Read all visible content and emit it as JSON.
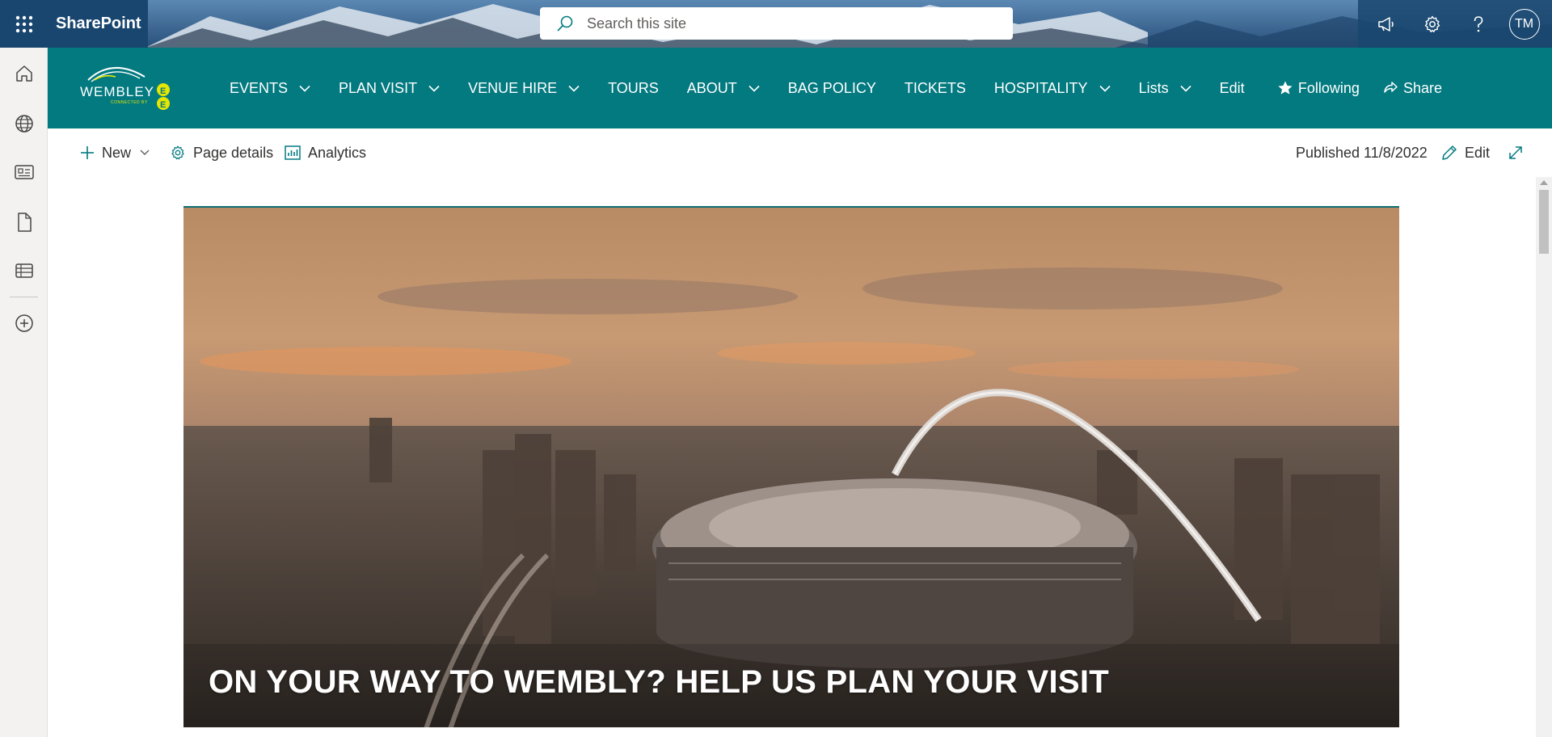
{
  "suite_bar": {
    "brand": "SharePoint",
    "search_placeholder": "Search this site",
    "avatar_initials": "TM"
  },
  "hub_nav": {
    "logo": {
      "text": "WEMBLEY",
      "sub_text": "CONNECTED BY",
      "partner_letters": "EE"
    },
    "items": [
      {
        "label": "EVENTS",
        "has_dropdown": true
      },
      {
        "label": "PLAN VISIT",
        "has_dropdown": true
      },
      {
        "label": "VENUE HIRE",
        "has_dropdown": true
      },
      {
        "label": "TOURS",
        "has_dropdown": false
      },
      {
        "label": "ABOUT",
        "has_dropdown": true
      },
      {
        "label": "BAG POLICY",
        "has_dropdown": false
      },
      {
        "label": "TICKETS",
        "has_dropdown": false
      },
      {
        "label": "HOSPITALITY",
        "has_dropdown": true
      },
      {
        "label": "Lists",
        "has_dropdown": true
      },
      {
        "label": "Edit",
        "has_dropdown": false
      }
    ],
    "following_label": "Following",
    "share_label": "Share"
  },
  "command_bar": {
    "new_label": "New",
    "page_details_label": "Page details",
    "analytics_label": "Analytics",
    "published_text": "Published 11/8/2022",
    "edit_label": "Edit"
  },
  "hero": {
    "title": "ON YOUR WAY TO WEMBLY? HELP US PLAN YOUR VISIT"
  },
  "colors": {
    "hub_nav_bg": "#037a80",
    "suite_dark": "#19466f",
    "logo_yellow": "#e6e600",
    "command_icon_accent": "#037a80"
  },
  "icons": {
    "suite_bar": [
      "waffle-icon",
      "search-icon",
      "megaphone-icon",
      "gear-icon",
      "help-icon"
    ],
    "app_bar": [
      "home-icon",
      "globe-icon",
      "news-icon",
      "file-icon",
      "list-icon",
      "add-icon"
    ],
    "command_bar": [
      "plus-icon",
      "chevron-down-icon",
      "gear-icon",
      "analytics-icon",
      "pencil-icon",
      "expand-icon"
    ],
    "hub_nav": [
      "star-icon",
      "share-icon",
      "chevron-down-icon"
    ]
  }
}
